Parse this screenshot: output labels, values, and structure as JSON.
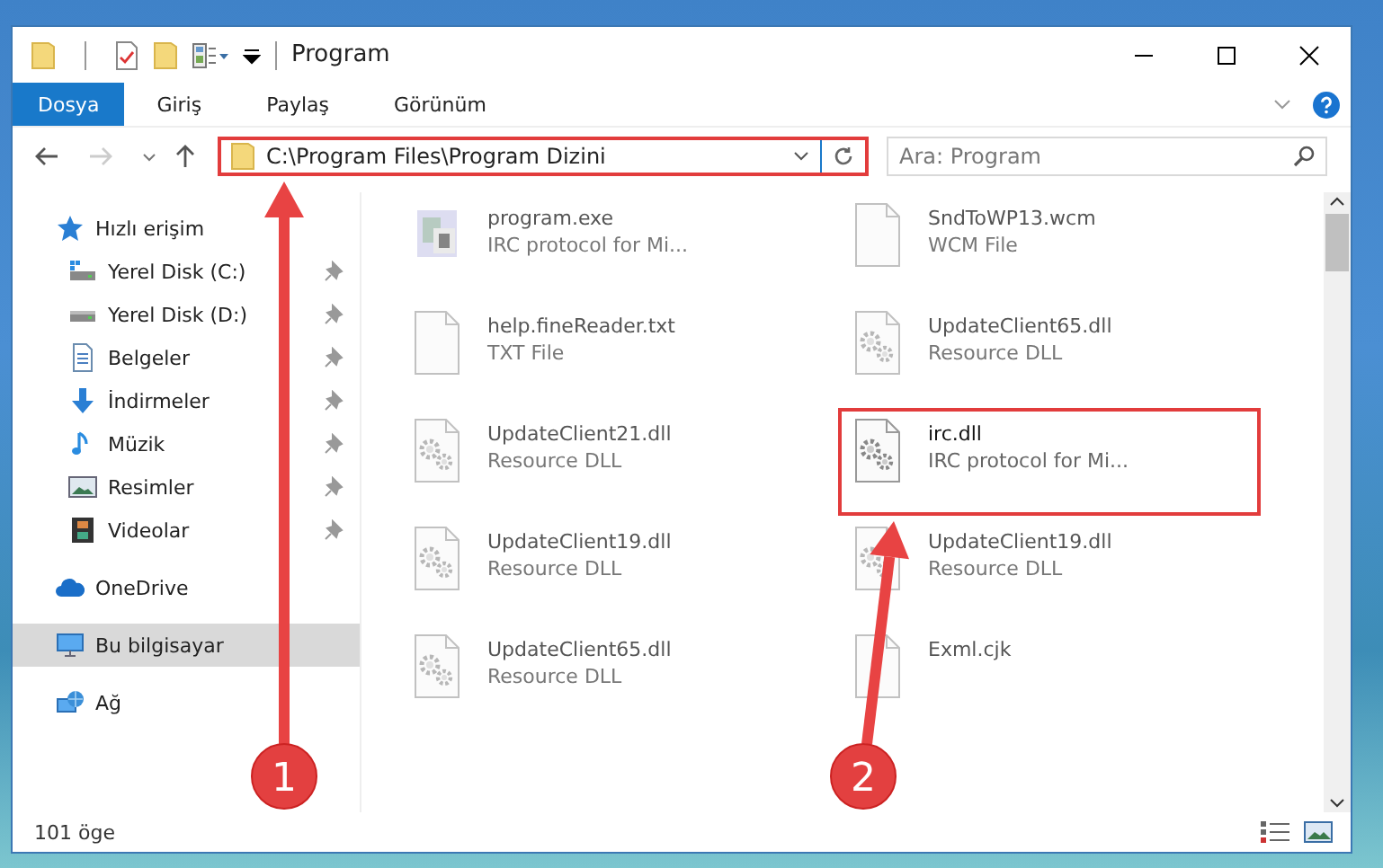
{
  "window": {
    "title": "Program"
  },
  "ribbon_tabs": [
    {
      "label": "Dosya",
      "selected": true
    },
    {
      "label": "Giriş",
      "selected": false
    },
    {
      "label": "Paylaş",
      "selected": false
    },
    {
      "label": "Görünüm",
      "selected": false
    }
  ],
  "address": {
    "path": "C:\\Program Files\\Program Dizini",
    "highlighted": true
  },
  "search": {
    "placeholder": "Ara: Program"
  },
  "sidebar": {
    "items": [
      {
        "label": "Hızlı erişim",
        "selected": false,
        "children": [
          {
            "label": "Yerel Disk (C:)",
            "pinned": true,
            "selected": false
          },
          {
            "label": "Yerel Disk (D:)",
            "pinned": true,
            "selected": false
          },
          {
            "label": "Belgeler",
            "pinned": true,
            "selected": false
          },
          {
            "label": "İndirmeler",
            "pinned": true,
            "selected": false
          },
          {
            "label": "Müzik",
            "pinned": true,
            "selected": false
          },
          {
            "label": "Resimler",
            "pinned": true,
            "selected": false
          },
          {
            "label": "Videolar",
            "pinned": true,
            "selected": false
          }
        ]
      },
      {
        "label": "OneDrive",
        "selected": false
      },
      {
        "label": "Bu bilgisayar",
        "selected": true
      },
      {
        "label": "Ağ",
        "selected": false
      }
    ]
  },
  "files": [
    {
      "name": "program.exe",
      "type": "IRC protocol for Mi...",
      "kind": "exe",
      "blurred": true,
      "highlighted": false
    },
    {
      "name": "SndToWP13.wcm",
      "type": "WCM File",
      "kind": "blank",
      "blurred": true,
      "highlighted": false
    },
    {
      "name": "help.fineReader.txt",
      "type": "TXT File",
      "kind": "blank",
      "blurred": true,
      "highlighted": false
    },
    {
      "name": "UpdateClient65.dll",
      "type": "Resource DLL",
      "kind": "gear",
      "blurred": true,
      "highlighted": false
    },
    {
      "name": "UpdateClient21.dll",
      "type": "Resource DLL",
      "kind": "gear",
      "blurred": true,
      "highlighted": false
    },
    {
      "name": "irc.dll",
      "type": "IRC protocol for Mi...",
      "kind": "gear",
      "blurred": false,
      "highlighted": true
    },
    {
      "name": "UpdateClient19.dll",
      "type": "Resource DLL",
      "kind": "gear",
      "blurred": true,
      "highlighted": false
    },
    {
      "name": "UpdateClient19.dll",
      "type": "Resource DLL",
      "kind": "gear",
      "blurred": true,
      "highlighted": false
    },
    {
      "name": "UpdateClient65.dll",
      "type": "Resource DLL",
      "kind": "gear",
      "blurred": true,
      "highlighted": false
    },
    {
      "name": "Exml.cjk",
      "kind": "blank",
      "blurred": true,
      "highlighted": false
    }
  ],
  "annotations": [
    {
      "number": "1"
    },
    {
      "number": "2"
    }
  ],
  "status_bar": {
    "count": "101 öge"
  }
}
